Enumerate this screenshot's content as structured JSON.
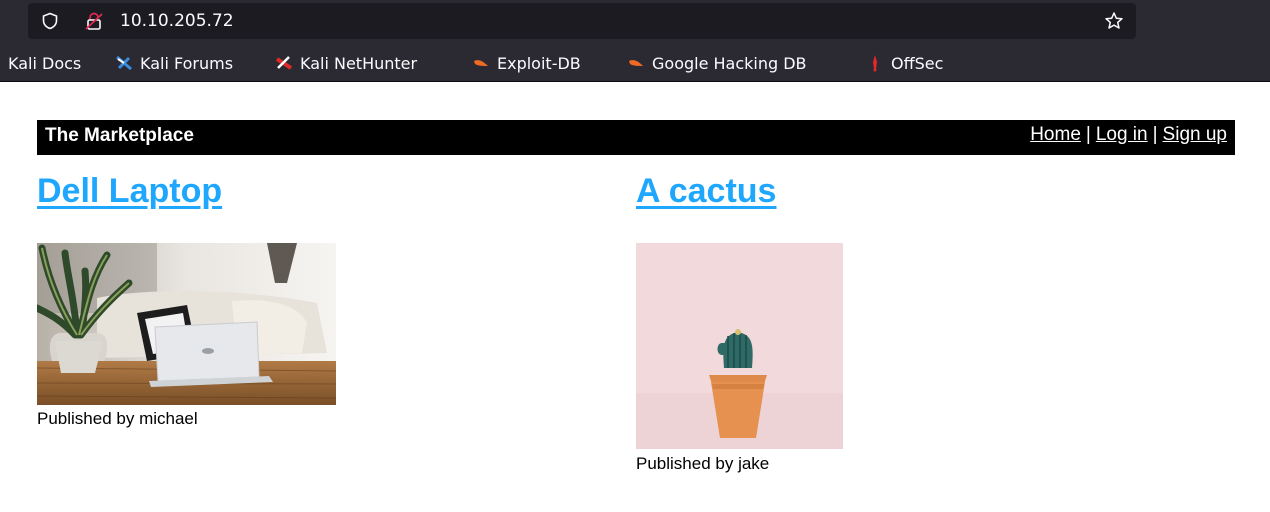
{
  "browser": {
    "url": "10.10.205.72",
    "bookmarks": [
      {
        "label": "Kali Docs",
        "icon": "none"
      },
      {
        "label": "Kali Forums",
        "icon": "kali-forums-icon"
      },
      {
        "label": "Kali NetHunter",
        "icon": "kali-nethunter-icon"
      },
      {
        "label": "Exploit-DB",
        "icon": "exploit-db-icon"
      },
      {
        "label": "Google Hacking DB",
        "icon": "google-hacking-db-icon"
      },
      {
        "label": "OffSec",
        "icon": "offsec-icon"
      }
    ]
  },
  "site": {
    "title": "The Marketplace",
    "nav": {
      "home": "Home",
      "login": "Log in",
      "signup": "Sign up",
      "separator": "|"
    }
  },
  "items": [
    {
      "title": "Dell Laptop",
      "published_by": "Published by michael",
      "image": "laptop-photo"
    },
    {
      "title": "A cactus",
      "published_by": "Published by jake",
      "image": "cactus-photo"
    }
  ],
  "colors": {
    "link": "#1ea7fd",
    "header_bg": "#000000",
    "chrome_bg": "#2b2a33"
  }
}
